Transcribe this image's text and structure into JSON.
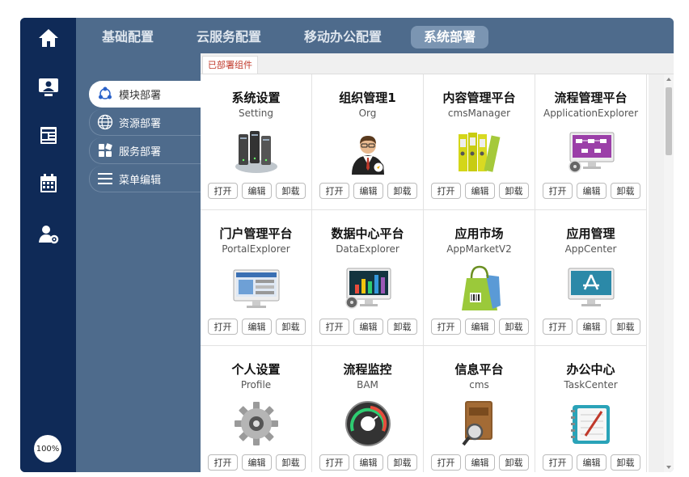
{
  "colors": {
    "sidebar": "#0f2a57",
    "topbar": "#4e6b8c",
    "active_tab": "#7b95b2",
    "content_tab_text": "#c0392b"
  },
  "leftbar": {
    "icons": [
      "home-icon",
      "monitor-user-icon",
      "newspaper-icon",
      "calendar-icon",
      "user-gear-icon"
    ],
    "zoom": "100%"
  },
  "tabs": [
    {
      "label": "基础配置",
      "active": false
    },
    {
      "label": "云服务配置",
      "active": false
    },
    {
      "label": "移动办公配置",
      "active": false
    },
    {
      "label": "系统部署",
      "active": true
    }
  ],
  "submenu": [
    {
      "label": "模块部署",
      "icon": "network-icon",
      "active": true
    },
    {
      "label": "资源部署",
      "icon": "globe-icon",
      "active": false
    },
    {
      "label": "服务部署",
      "icon": "tiles-icon",
      "active": false
    },
    {
      "label": "菜单编辑",
      "icon": "menu-icon",
      "active": false
    }
  ],
  "content_tab": "已部署组件",
  "button_labels": {
    "open": "打开",
    "edit": "编辑",
    "uninstall": "卸载"
  },
  "cards": [
    {
      "title": "系统设置",
      "subtitle": "Setting",
      "icon": "servers-icon"
    },
    {
      "title": "组织管理1",
      "subtitle": "Org",
      "icon": "businessman-icon"
    },
    {
      "title": "内容管理平台",
      "subtitle": "cmsManager",
      "icon": "binders-icon"
    },
    {
      "title": "流程管理平台",
      "subtitle": "ApplicationExplorer",
      "icon": "flow-monitor-icon"
    },
    {
      "title": "门户管理平台",
      "subtitle": "PortalExplorer",
      "icon": "portal-monitor-icon"
    },
    {
      "title": "数据中心平台",
      "subtitle": "DataExplorer",
      "icon": "chart-monitor-icon"
    },
    {
      "title": "应用市场",
      "subtitle": "AppMarketV2",
      "icon": "shopping-bag-icon"
    },
    {
      "title": "应用管理",
      "subtitle": "AppCenter",
      "icon": "appstore-monitor-icon"
    },
    {
      "title": "个人设置",
      "subtitle": "Profile",
      "icon": "gear-icon"
    },
    {
      "title": "流程监控",
      "subtitle": "BAM",
      "icon": "gauge-icon"
    },
    {
      "title": "信息平台",
      "subtitle": "cms",
      "icon": "book-magnifier-icon"
    },
    {
      "title": "办公中心",
      "subtitle": "TaskCenter",
      "icon": "notebook-icon"
    }
  ]
}
